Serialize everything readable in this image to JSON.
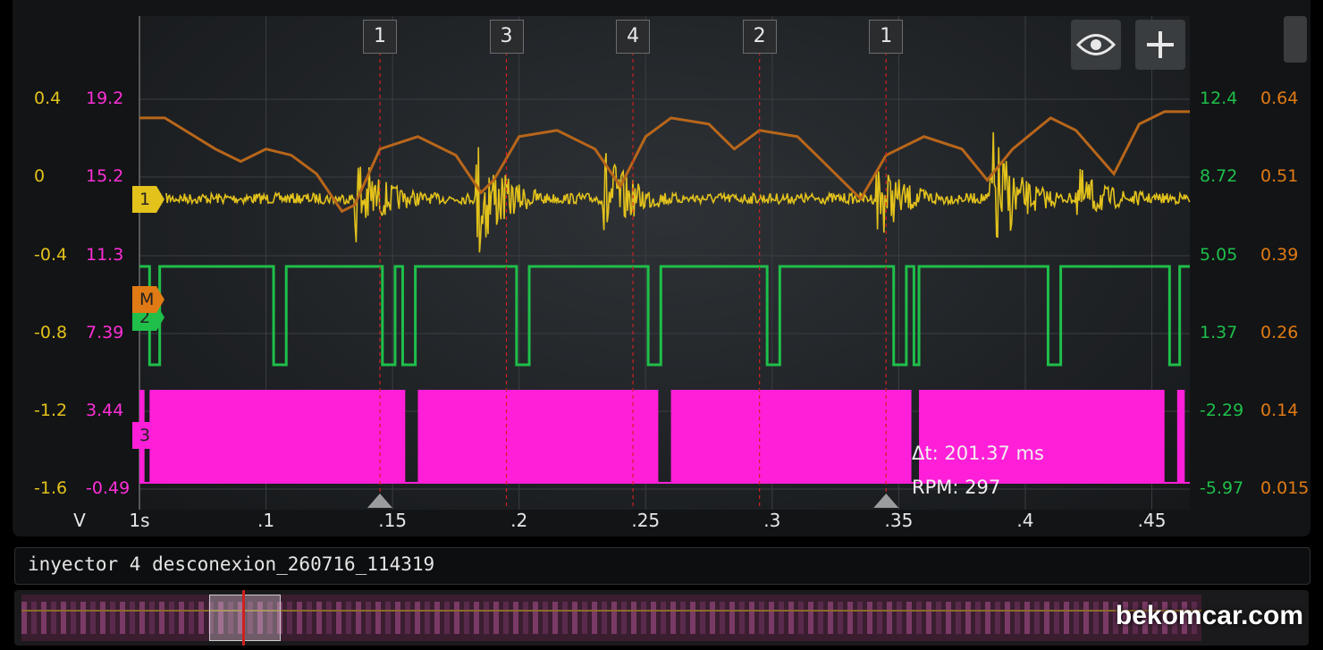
{
  "chart_data": {
    "type": "line",
    "x_unit": "s",
    "xlim": [
      0.05,
      0.465
    ],
    "x_ticks": [
      ".1",
      ".15",
      ".2",
      ".25",
      ".3",
      ".35",
      ".4",
      ".45"
    ],
    "x_tick_values": [
      0.1,
      0.15,
      0.2,
      0.25,
      0.3,
      0.35,
      0.4,
      0.45
    ],
    "x_start_label": "1s",
    "y_unit_label": "V",
    "axes": {
      "left_yellow": [
        "0.4",
        "0",
        "-0.4",
        "-0.8",
        "-1.2",
        "-1.6"
      ],
      "left_magenta": [
        "19.2",
        "15.2",
        "11.3",
        "7.39",
        "3.44",
        "-0.49"
      ],
      "right_green": [
        "12.4",
        "8.72",
        "5.05",
        "1.37",
        "-2.29",
        "-5.97"
      ],
      "right_orange": [
        "0.64",
        "0.51",
        "0.39",
        "0.26",
        "0.14",
        "0.015"
      ]
    },
    "cylinder_markers": [
      {
        "label": "1",
        "x": 0.145
      },
      {
        "label": "3",
        "x": 0.195
      },
      {
        "label": "4",
        "x": 0.245
      },
      {
        "label": "2",
        "x": 0.295
      },
      {
        "label": "1",
        "x": 0.345
      }
    ],
    "series": [
      {
        "name": "1",
        "color": "#e3c21c",
        "bursts_x": [
          0.137,
          0.185,
          0.235,
          0.343,
          0.388,
          0.422
        ],
        "burst_amplitude": [
          0.7,
          0.95,
          0.75,
          0.55,
          1.0,
          0.4
        ]
      },
      {
        "name": "2",
        "color": "#1fbf4a",
        "low_pulses_x": [
          [
            0.054,
            0.058
          ],
          [
            0.103,
            0.108
          ],
          [
            0.146,
            0.151
          ],
          [
            0.154,
            0.159
          ],
          [
            0.199,
            0.204
          ],
          [
            0.251,
            0.256
          ],
          [
            0.298,
            0.303
          ],
          [
            0.348,
            0.353
          ],
          [
            0.356,
            0.358
          ],
          [
            0.409,
            0.414
          ],
          [
            0.457,
            0.461
          ]
        ]
      },
      {
        "name": "3",
        "color": "#ff1fd8",
        "gaps_x": [
          [
            0.052,
            0.054
          ],
          [
            0.155,
            0.16
          ],
          [
            0.255,
            0.26
          ],
          [
            0.355,
            0.358
          ],
          [
            0.455,
            0.46
          ]
        ]
      },
      {
        "name": "M",
        "color": "#c9761c",
        "points": [
          [
            0.05,
            0.61
          ],
          [
            0.06,
            0.61
          ],
          [
            0.08,
            0.56
          ],
          [
            0.09,
            0.54
          ],
          [
            0.1,
            0.56
          ],
          [
            0.11,
            0.55
          ],
          [
            0.12,
            0.52
          ],
          [
            0.13,
            0.46
          ],
          [
            0.135,
            0.47
          ],
          [
            0.145,
            0.56
          ],
          [
            0.16,
            0.58
          ],
          [
            0.175,
            0.55
          ],
          [
            0.185,
            0.49
          ],
          [
            0.19,
            0.51
          ],
          [
            0.2,
            0.58
          ],
          [
            0.215,
            0.59
          ],
          [
            0.23,
            0.56
          ],
          [
            0.24,
            0.5
          ],
          [
            0.25,
            0.58
          ],
          [
            0.26,
            0.61
          ],
          [
            0.275,
            0.6
          ],
          [
            0.285,
            0.56
          ],
          [
            0.295,
            0.59
          ],
          [
            0.31,
            0.58
          ],
          [
            0.32,
            0.54
          ],
          [
            0.335,
            0.48
          ],
          [
            0.345,
            0.55
          ],
          [
            0.36,
            0.58
          ],
          [
            0.375,
            0.56
          ],
          [
            0.385,
            0.51
          ],
          [
            0.395,
            0.56
          ],
          [
            0.41,
            0.61
          ],
          [
            0.42,
            0.59
          ],
          [
            0.435,
            0.52
          ],
          [
            0.445,
            0.6
          ],
          [
            0.455,
            0.62
          ],
          [
            0.465,
            0.62
          ]
        ]
      }
    ]
  },
  "measurement": {
    "delta_t": "Δt: 201.37 ms",
    "rpm": "RPM: 297"
  },
  "file_name": "inyector 4 desconexion_260716_114319",
  "watermark": "bekomcar.com",
  "icons": {
    "eye": "eye-icon",
    "add": "plus-icon"
  },
  "colors": {
    "yellow": "#e3c21c",
    "magenta": "#ff1fd8",
    "green": "#1fbf4a",
    "orange": "#d47a1e",
    "cursor": "#d02020"
  }
}
